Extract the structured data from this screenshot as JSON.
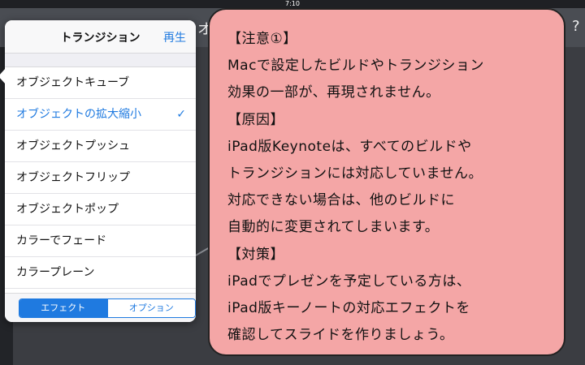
{
  "status": {
    "time": "7:10"
  },
  "popover": {
    "title": "トランジション",
    "play_label": "再生",
    "items": [
      {
        "label": "オブジェクトキューブ",
        "selected": false
      },
      {
        "label": "オブジェクトの拡大縮小",
        "selected": true
      },
      {
        "label": "オブジェクトプッシュ",
        "selected": false
      },
      {
        "label": "オブジェクトフリップ",
        "selected": false
      },
      {
        "label": "オブジェクトポップ",
        "selected": false
      },
      {
        "label": "カラーでフェード",
        "selected": false
      },
      {
        "label": "カラープレーン",
        "selected": false
      }
    ],
    "check_mark": "✓",
    "tabs": {
      "effect": "エフェクト",
      "options": "オプション",
      "active": "effect"
    }
  },
  "toolbar": {
    "ghost_left": "オ",
    "ghost_right": "?"
  },
  "slide": {
    "partial_text": "e"
  },
  "note": {
    "lines": [
      "【注意①】",
      "Macで設定したビルドやトランジション",
      "効果の一部が、再現されません。",
      "【原因】",
      "iPad版Keynoteは、すべてのビルドや",
      "トランジションには対応していません。",
      "対応できない場合は、他のビルドに",
      "自動的に変更されてしまいます。",
      "【対策】",
      "iPadでプレゼンを予定している方は、",
      "iPad版キーノートの対応エフェクトを",
      "確認してスライドを作りましょう。"
    ]
  },
  "colors": {
    "accent": "#1f7ae0",
    "note_bg": "#f4a6a6"
  }
}
